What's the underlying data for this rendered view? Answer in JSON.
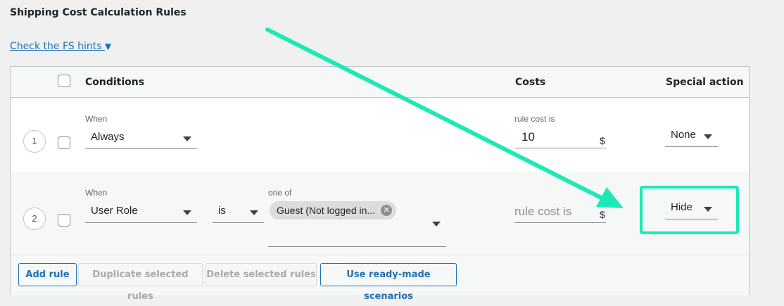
{
  "section_title": "Shipping Cost Calculation Rules",
  "hints_link": "Check the FS hints",
  "hints_arrow": "▼",
  "columns": {
    "conditions": "Conditions",
    "costs": "Costs",
    "special_action": "Special action"
  },
  "rows": [
    {
      "number": "1",
      "when_label": "When",
      "condition": "Always",
      "cost_label": "rule cost is",
      "cost_value": "10",
      "currency": "$",
      "special_action": "None"
    },
    {
      "number": "2",
      "when_label": "When",
      "condition": "User Role",
      "operator": "is",
      "one_of_label": "one of",
      "chip": "Guest (Not logged in...",
      "cost_placeholder": "rule cost is",
      "currency": "$",
      "special_action": "Hide"
    }
  ],
  "buttons": {
    "add_rule": "Add rule",
    "duplicate": "Duplicate selected rules",
    "delete": "Delete selected rules",
    "scenarios": "Use ready-made scenarios"
  },
  "colors": {
    "accent": "#2271b1",
    "highlight": "#1de9b6"
  }
}
